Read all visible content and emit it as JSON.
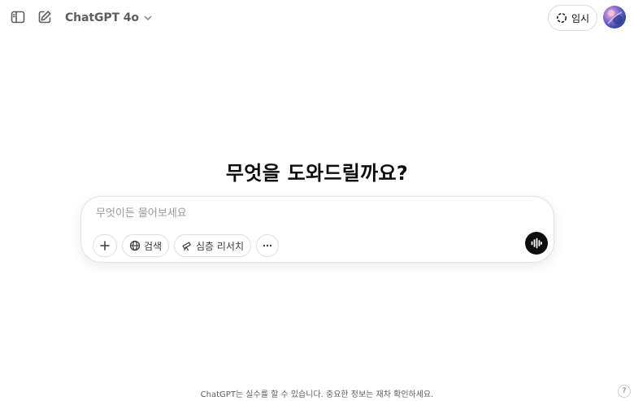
{
  "header": {
    "model_name": "ChatGPT 4o",
    "temporary_chat_label": "임시"
  },
  "main": {
    "heading": "무엇을 도와드릴까요?",
    "composer": {
      "placeholder": "무엇이든 물어보세요",
      "value": "",
      "search_label": "검색",
      "deep_research_label": "심층 리서치"
    }
  },
  "footer": {
    "disclaimer": "ChatGPT는 실수를 할 수 있습니다. 중요한 정보는 재차 확인하세요.",
    "help_label": "?"
  },
  "icons": {
    "sidebar_toggle": "sidebar-icon",
    "new_chat": "edit-icon",
    "model_dropdown": "chevron-down-icon",
    "temporary_chat": "dashed-circle-icon",
    "plus": "plus-icon",
    "search": "globe-icon",
    "deep_research": "telescope-icon",
    "more": "ellipsis-icon",
    "voice": "voice-waveform-icon"
  },
  "colors": {
    "text": "#0d0d0d",
    "muted": "#5d5d5d",
    "placeholder": "#9b9b9b",
    "border": "#dedede",
    "voice_button": "#0d0d0d"
  }
}
